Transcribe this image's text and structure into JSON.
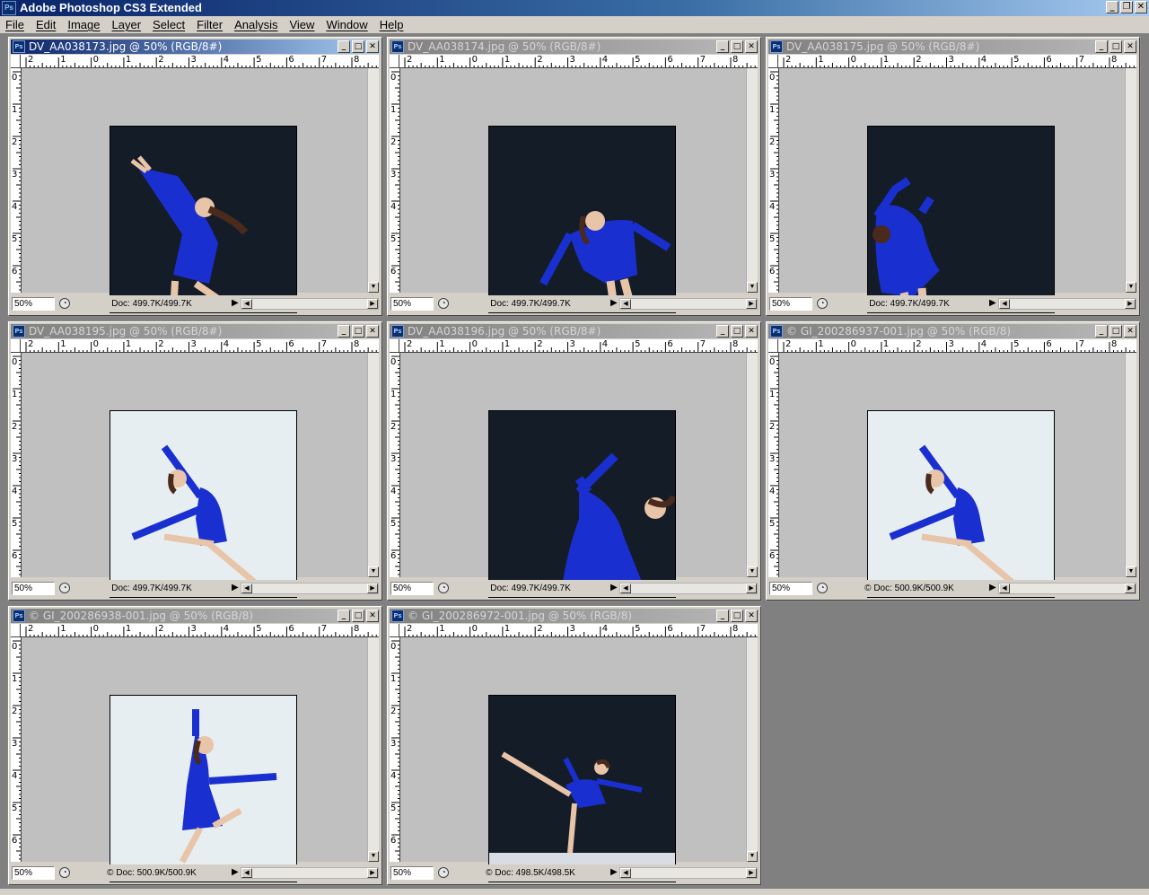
{
  "app": {
    "title": "Adobe Photoshop CS3 Extended",
    "logo": "Ps",
    "controls": {
      "minimize": "_",
      "restore": "❐",
      "close": "✕"
    }
  },
  "menubar": {
    "items": [
      "File",
      "Edit",
      "Image",
      "Layer",
      "Select",
      "Filter",
      "Analysis",
      "View",
      "Window",
      "Help"
    ]
  },
  "documents": [
    {
      "title": "DV_AA038173.jpg @ 50% (RGB/8#)",
      "active": true,
      "zoom": "50%",
      "doc_size": "Doc: 499.7K/499.7K",
      "scene": "dark",
      "pose": "backbend"
    },
    {
      "title": "DV_AA038174.jpg @ 50% (RGB/8#)",
      "active": false,
      "zoom": "50%",
      "doc_size": "Doc: 499.7K/499.7K",
      "scene": "dark",
      "pose": "spin"
    },
    {
      "title": "DV_AA038175.jpg @ 50% (RGB/8#)",
      "active": false,
      "zoom": "50%",
      "doc_size": "Doc: 499.7K/499.7K",
      "scene": "dark",
      "pose": "arch"
    },
    {
      "title": "DV_AA038195.jpg @ 50% (RGB/8#)",
      "active": false,
      "zoom": "50%",
      "doc_size": "Doc: 499.7K/499.7K",
      "scene": "light",
      "pose": "glide"
    },
    {
      "title": "DV_AA038196.jpg @ 50% (RGB/8#)",
      "active": false,
      "zoom": "50%",
      "doc_size": "Doc: 499.7K/499.7K",
      "scene": "dark",
      "pose": "reach"
    },
    {
      "title": "© GI_200286937-001.jpg @ 50% (RGB/8)",
      "active": false,
      "zoom": "50%",
      "doc_size": "© Doc: 500.9K/500.9K",
      "scene": "light",
      "pose": "glide"
    },
    {
      "title": "© GI_200286938-001.jpg @ 50% (RGB/8)",
      "active": false,
      "zoom": "50%",
      "doc_size": "© Doc: 500.9K/500.9K",
      "scene": "light",
      "pose": "lunge"
    },
    {
      "title": "© GI_200286972-001.jpg @ 50% (RGB/8)",
      "active": false,
      "zoom": "50%",
      "doc_size": "© Doc: 498.5K/498.5K",
      "scene": "dark",
      "pose": "arabesque"
    }
  ],
  "ruler": {
    "horizontal_labels": [
      "2",
      "1",
      "0",
      "1",
      "2",
      "3",
      "4",
      "5",
      "6",
      "7",
      "8"
    ],
    "vertical_labels": [
      "0",
      "1",
      "2",
      "3",
      "4",
      "5",
      "6"
    ]
  },
  "colors": {
    "desktop": "#808080",
    "active_title_start": "#0a246a",
    "active_title_end": "#a6caf0",
    "inactive_title_start": "#808080",
    "inactive_title_end": "#b9b9b9",
    "canvas_bg": "#c0c0c0",
    "dress_blue": "#1a2fd0",
    "dark_photo_bg": "#141c28",
    "light_photo_bg": "#e6eef2"
  }
}
